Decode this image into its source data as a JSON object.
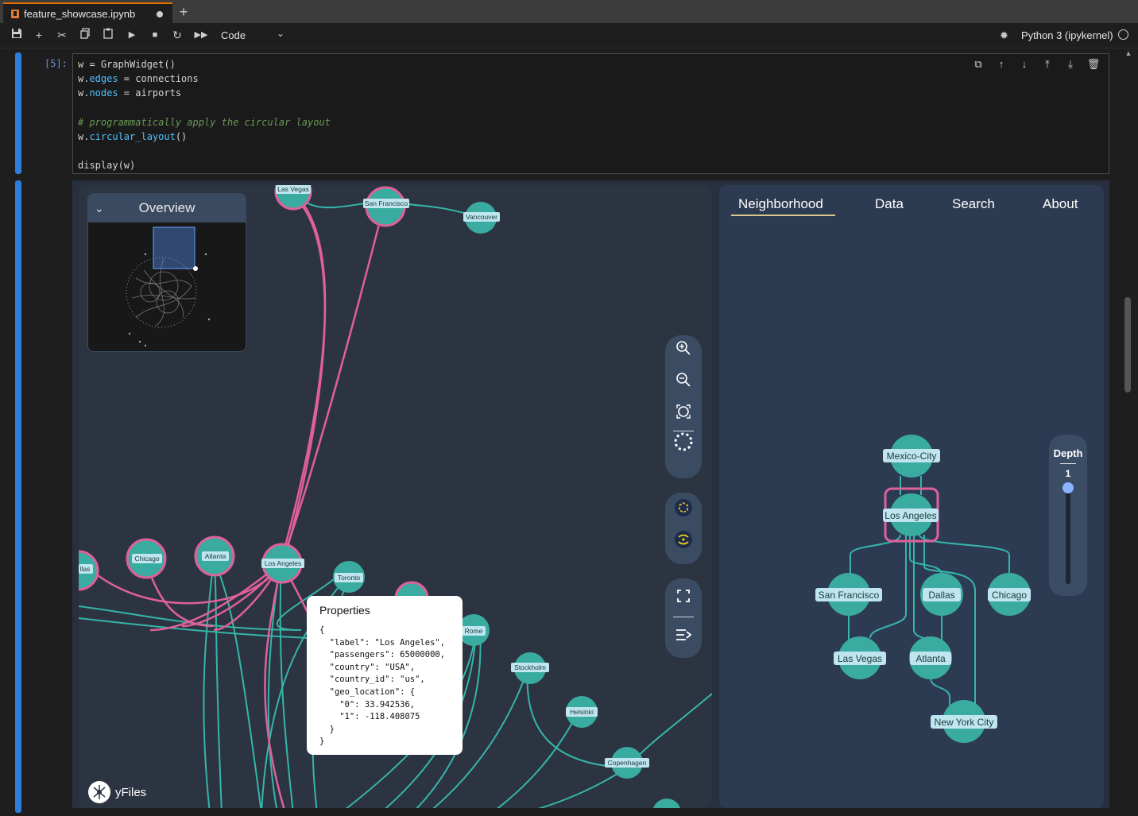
{
  "tab": {
    "title": "feature_showcase.ipynb",
    "new_tab": "+"
  },
  "toolbar": {
    "cell_type": "Code",
    "kernel": "Python 3 (ipykernel)"
  },
  "cell": {
    "prompt": "[5]:",
    "code": [
      [
        {
          "t": "w ",
          "c": ""
        },
        {
          "t": "=",
          "c": "op"
        },
        {
          "t": " GraphWidget()",
          "c": ""
        }
      ],
      [
        {
          "t": "w.",
          "c": ""
        },
        {
          "t": "edges",
          "c": "k"
        },
        {
          "t": " = connections",
          "c": ""
        }
      ],
      [
        {
          "t": "w.",
          "c": ""
        },
        {
          "t": "nodes",
          "c": "k"
        },
        {
          "t": " = airports",
          "c": ""
        }
      ],
      [
        {
          "t": "",
          "c": ""
        }
      ],
      [
        {
          "t": "# programmatically apply the circular layout",
          "c": "c"
        }
      ],
      [
        {
          "t": "w.",
          "c": ""
        },
        {
          "t": "circular_layout",
          "c": "k"
        },
        {
          "t": "()",
          "c": ""
        }
      ],
      [
        {
          "t": "",
          "c": ""
        }
      ],
      [
        {
          "t": "display(w)",
          "c": ""
        }
      ]
    ]
  },
  "overview": {
    "title": "Overview"
  },
  "properties": {
    "title": "Properties",
    "json": "{\n  \"label\": \"Los Angeles\",\n  \"passengers\": 65000000,\n  \"country\": \"USA\",\n  \"country_id\": \"us\",\n  \"geo_location\": {\n    \"0\": 33.942536,\n    \"1\": -118.408075\n  }\n}"
  },
  "brand": {
    "name": "yFiles"
  },
  "side_tabs": [
    "Neighborhood",
    "Data",
    "Search",
    "About"
  ],
  "depth": {
    "label": "Depth",
    "value": "1"
  },
  "graph_nodes": {
    "las_vegas": "Las Vegas",
    "san_francisco": "San Francisco",
    "vancouver": "Vancouver",
    "dallas_partial": "llas",
    "chicago": "Chicago",
    "atlanta": "Atlanta",
    "los_angeles": "Los Angeles",
    "toronto": "Toronto",
    "rome": "Rome",
    "stockholm": "Stockholm",
    "helsinki": "Helsinki",
    "copenhagen": "Copenhagen"
  },
  "neighborhood_nodes": {
    "mexico_city": "Mexico-City",
    "los_angeles": "Los Angeles",
    "san_francisco": "San Francisco",
    "dallas": "Dallas",
    "chicago": "Chicago",
    "las_vegas": "Las Vegas",
    "atlanta": "Atlanta",
    "new_york": "New York City"
  },
  "colors": {
    "node": "#3aaba0",
    "highlight": "#e0609a",
    "edge": "#35b5aa",
    "label_bg": "#bfe6ee"
  }
}
